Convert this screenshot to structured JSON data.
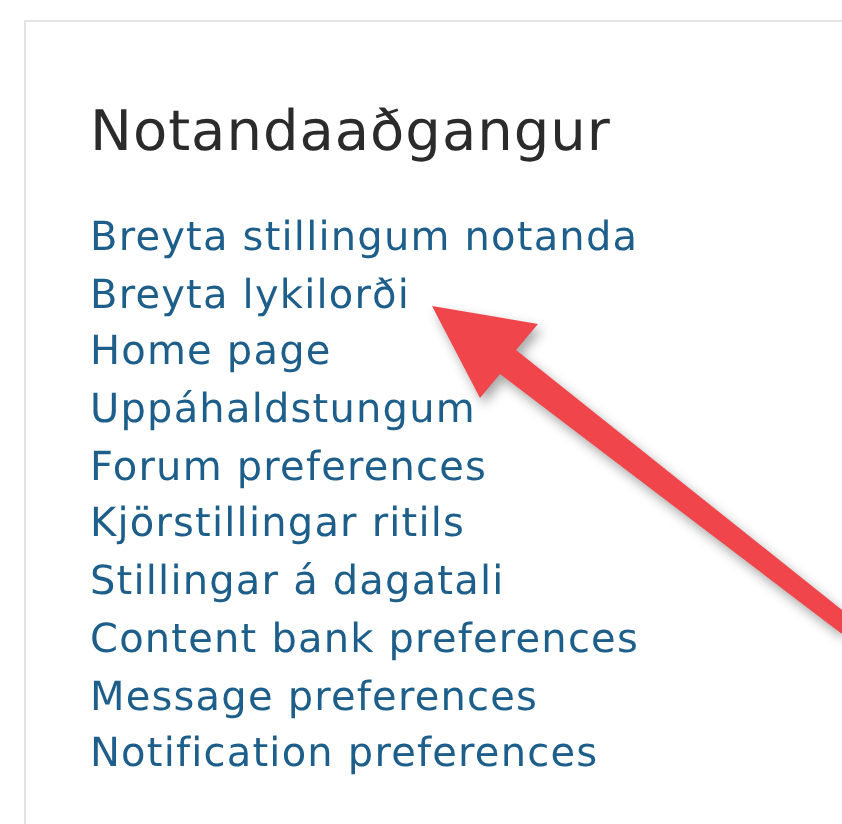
{
  "card": {
    "title": "Notandaaðgangur",
    "links": [
      {
        "label": "Breyta stillingum notanda"
      },
      {
        "label": "Breyta lykilorði"
      },
      {
        "label": "Home page"
      },
      {
        "label": "Uppáhaldstungum"
      },
      {
        "label": "Forum preferences"
      },
      {
        "label": "Kjörstillingar ritils"
      },
      {
        "label": "Stillingar á dagatali"
      },
      {
        "label": "Content bank preferences"
      },
      {
        "label": "Message preferences"
      },
      {
        "label": "Notification preferences"
      }
    ]
  }
}
